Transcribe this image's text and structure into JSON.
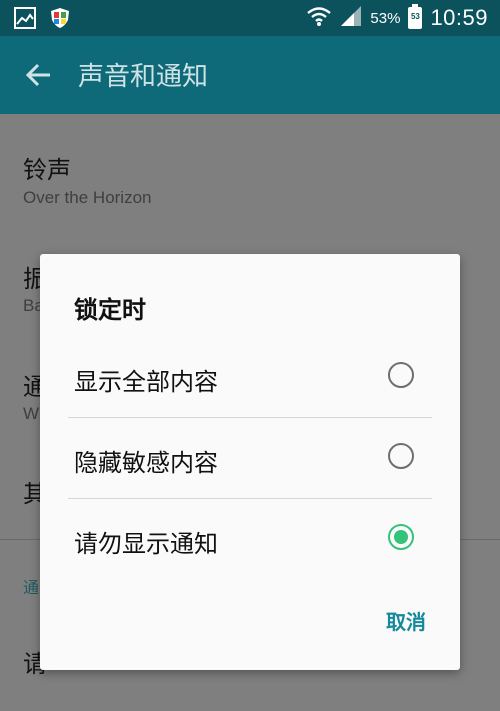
{
  "status_bar": {
    "battery_percent": "53%",
    "battery_level": "53",
    "time": "10:59",
    "icons": [
      "gallery-icon",
      "shield-icon",
      "wifi-icon",
      "signal-icon",
      "battery-icon"
    ]
  },
  "app_bar": {
    "title": "声音和通知",
    "back_icon": "arrow-left-icon"
  },
  "background_list": {
    "items": [
      {
        "title": "铃声",
        "subtitle": "Over the Horizon"
      },
      {
        "title": "振",
        "subtitle": "Ba"
      },
      {
        "title": "通",
        "subtitle": "W"
      },
      {
        "title": "其",
        "subtitle": ""
      }
    ],
    "section_header": "通",
    "last_item_title": "请"
  },
  "dialog": {
    "title": "锁定时",
    "options": [
      {
        "label": "显示全部内容",
        "selected": false
      },
      {
        "label": "隐藏敏感内容",
        "selected": false
      },
      {
        "label": "请勿显示通知",
        "selected": true
      }
    ],
    "cancel_label": "取消"
  },
  "colors": {
    "status_bar": "#0b525d",
    "app_bar": "#0e6a78",
    "radio_selected": "#35c27a",
    "cancel_text": "#138a9b"
  }
}
